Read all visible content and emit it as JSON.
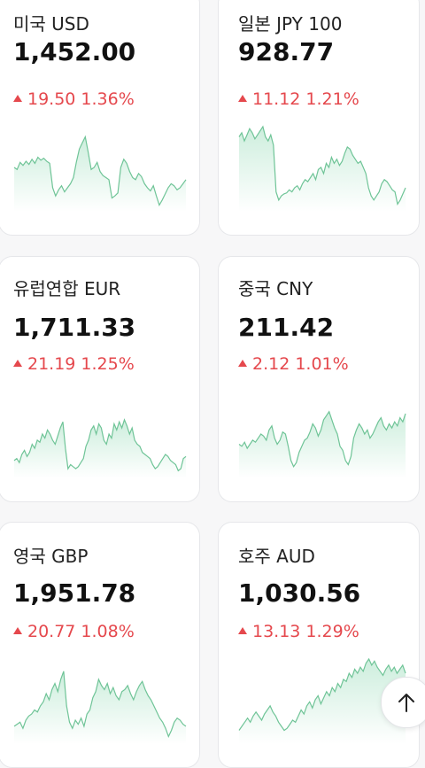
{
  "cards": [
    {
      "name": "미국 USD",
      "rate": "1,452.00",
      "delta": "19.50",
      "percent": "1.36%",
      "trend": [
        40,
        38,
        45,
        42,
        46,
        43,
        48,
        44,
        50,
        47,
        49,
        46,
        44,
        20,
        12,
        18,
        22,
        16,
        20,
        24,
        30,
        45,
        58,
        64,
        70,
        55,
        38,
        40,
        45,
        36,
        32,
        30,
        28,
        10,
        12,
        15,
        40,
        48,
        44,
        36,
        30,
        28,
        34,
        31,
        24,
        20,
        17,
        22,
        12,
        3,
        8,
        14,
        20,
        24,
        22,
        18,
        20,
        24,
        28
      ]
    },
    {
      "name": "일본 JPY 100",
      "rate": "928.77",
      "delta": "11.12",
      "percent": "1.21%",
      "trend": [
        70,
        74,
        66,
        72,
        78,
        74,
        68,
        72,
        76,
        80,
        70,
        66,
        72,
        62,
        16,
        8,
        12,
        14,
        15,
        18,
        16,
        20,
        22,
        18,
        24,
        28,
        26,
        30,
        34,
        28,
        38,
        40,
        34,
        44,
        40,
        50,
        44,
        48,
        42,
        46,
        54,
        60,
        58,
        52,
        48,
        44,
        46,
        40,
        34,
        20,
        12,
        8,
        12,
        16,
        24,
        28,
        26,
        22,
        18,
        16,
        4,
        8,
        14,
        20
      ]
    },
    {
      "name": "유럽연합 EUR",
      "rate": "1,711.33",
      "delta": "21.19",
      "percent": "1.25%",
      "trend": [
        14,
        16,
        12,
        20,
        24,
        18,
        22,
        30,
        26,
        34,
        32,
        40,
        36,
        44,
        40,
        34,
        30,
        38,
        46,
        52,
        26,
        6,
        10,
        8,
        6,
        8,
        12,
        16,
        28,
        34,
        44,
        48,
        40,
        50,
        46,
        34,
        30,
        40,
        36,
        50,
        44,
        52,
        46,
        54,
        48,
        40,
        46,
        34,
        30,
        28,
        22,
        20,
        18,
        16,
        10,
        6,
        8,
        12,
        16,
        20,
        18,
        14,
        12,
        10,
        4,
        6,
        16,
        18
      ]
    },
    {
      "name": "중국 CNY",
      "rate": "211.42",
      "delta": "2.12",
      "percent": "1.01%",
      "trend": [
        30,
        28,
        32,
        26,
        30,
        34,
        32,
        36,
        40,
        38,
        34,
        44,
        48,
        36,
        30,
        34,
        42,
        40,
        28,
        14,
        8,
        12,
        22,
        28,
        34,
        36,
        42,
        50,
        46,
        38,
        44,
        54,
        58,
        62,
        54,
        46,
        40,
        28,
        24,
        14,
        10,
        18,
        36,
        44,
        50,
        46,
        40,
        44,
        36,
        40,
        46,
        52,
        56,
        48,
        44,
        50,
        46,
        52,
        48,
        56,
        52,
        60
      ]
    },
    {
      "name": "영국 GBP",
      "rate": "1,951.78",
      "delta": "20.77",
      "percent": "1.08%",
      "trend": [
        14,
        16,
        18,
        12,
        20,
        24,
        26,
        30,
        28,
        34,
        38,
        46,
        40,
        50,
        56,
        48,
        60,
        68,
        34,
        18,
        12,
        20,
        16,
        22,
        14,
        26,
        30,
        42,
        48,
        60,
        54,
        50,
        56,
        46,
        52,
        44,
        40,
        48,
        50,
        54,
        46,
        40,
        48,
        54,
        58,
        50,
        44,
        40,
        34,
        28,
        22,
        18,
        12,
        4,
        10,
        18,
        22,
        20,
        16,
        14
      ]
    },
    {
      "name": "호주 AUD",
      "rate": "1,030.56",
      "delta": "13.13",
      "percent": "1.29%",
      "trend": [
        10,
        14,
        18,
        22,
        18,
        24,
        28,
        24,
        20,
        26,
        30,
        34,
        28,
        24,
        18,
        14,
        10,
        12,
        16,
        20,
        18,
        24,
        30,
        26,
        34,
        38,
        32,
        40,
        44,
        36,
        42,
        48,
        44,
        52,
        48,
        56,
        52,
        60,
        58,
        66,
        62,
        70,
        66,
        72,
        68,
        76,
        80,
        74,
        78,
        72,
        68,
        64,
        70,
        74,
        68,
        72,
        66,
        70,
        74,
        66
      ]
    }
  ],
  "scroll_top_icon": "arrow-up-icon",
  "colors": {
    "up": "#e5484d",
    "spark_line": "#6fc497",
    "spark_fill_top": "#cdeedd",
    "spark_fill_bottom": "#ffffff"
  }
}
